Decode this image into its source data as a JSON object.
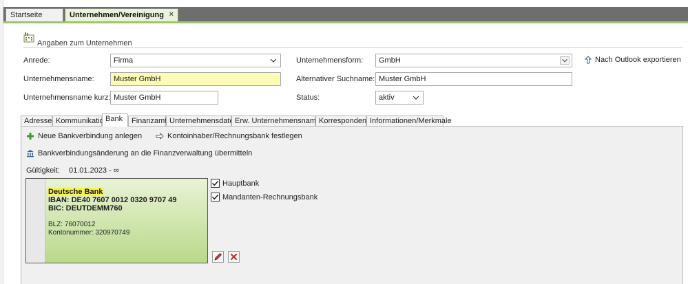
{
  "tabs": [
    {
      "label": "Startseite",
      "active": false
    },
    {
      "label": "Unternehmen/Vereinigung",
      "active": true
    }
  ],
  "tab_close_glyph": "×",
  "section": {
    "title": "Angaben zum Unternehmen",
    "icon": "factory-icon"
  },
  "form": {
    "anrede_label": "Anrede:",
    "anrede_value": "Firma",
    "unternehmensname_label": "Unternehmensname:",
    "unternehmensname_value": "Muster GmbH",
    "kurz_label": "Unternehmensname kurz:",
    "kurz_value": "Muster GmbH",
    "form_label": "Unternehmensform:",
    "form_value": "GmbH",
    "alt_label": "Alternativer Suchname:",
    "alt_value": "Muster GmbH",
    "status_label": "Status:",
    "status_value": "aktiv"
  },
  "export": {
    "label": "Nach Outlook exportieren",
    "icon": "arrow-up-icon"
  },
  "subtabs": [
    "Adresse",
    "Kommunikation",
    "Bank",
    "Finanzamt",
    "Unternehmensdaten",
    "Erw. Unternehmensnamen",
    "Korrespondenz",
    "Informationen/Merkmale"
  ],
  "active_subtab": "Bank",
  "bank_tab": {
    "new_label": "Neue Bankverbindung anlegen",
    "holder_label": "Kontoinhaber/Rechnungsbank festlegen",
    "transmit_label": "Bankverbindungsänderung an die Finanzverwaltung übermitteln",
    "validity_label": "Gültigkeit:",
    "validity_value": "01.01.2023 - ∞"
  },
  "bank_card": {
    "name": "Deutsche Bank",
    "iban": "IBAN:  DE40 7607 0012 0320 9707 49",
    "bic": "BIC:  DEUTDEMM760",
    "blz": "BLZ:  76070012",
    "konto": "Kontonummer:  320970749"
  },
  "checkboxes": [
    {
      "label": "Hauptbank",
      "checked": true
    },
    {
      "label": "Mandanten-Rechnungsbank",
      "checked": true
    }
  ],
  "colors": {
    "accent": "#9bc767",
    "highlight": "#fdfcb4",
    "card_top": "#e9f3d6",
    "card_bottom": "#b9d98a"
  }
}
